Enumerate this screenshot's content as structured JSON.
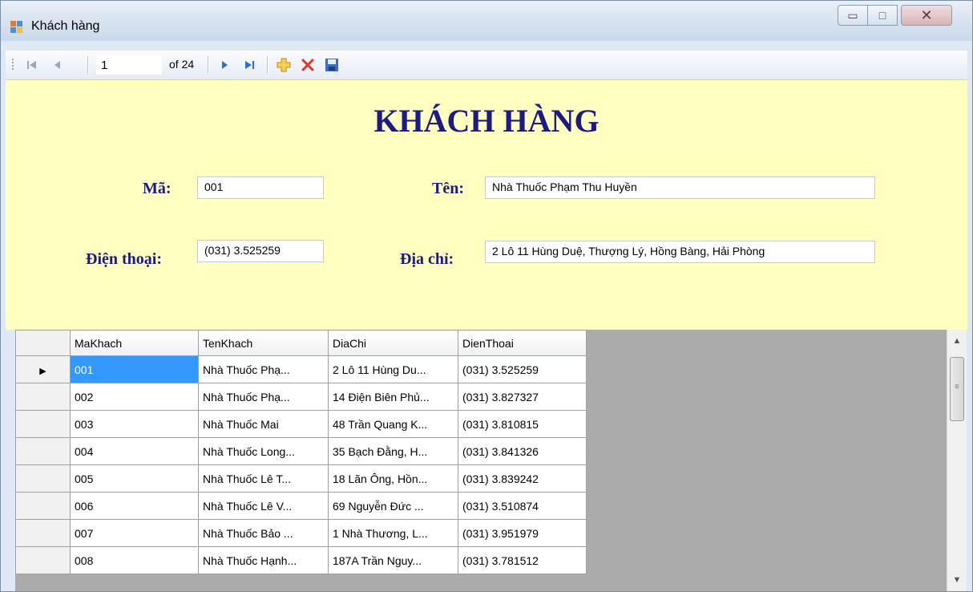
{
  "window": {
    "title": "Khách hàng",
    "controls": {
      "minimize": "▭",
      "maximize": "□",
      "close": "✕"
    }
  },
  "toolbar": {
    "position": "1",
    "count_label": "of 24",
    "icons": [
      "move-first-icon",
      "move-previous-icon",
      "move-next-icon",
      "move-last-icon",
      "add-new-icon",
      "delete-icon",
      "save-icon"
    ]
  },
  "form": {
    "heading": "KHÁCH HÀNG",
    "ma_label": "Mã:",
    "ma_value": "001",
    "ten_label": "Tên:",
    "ten_value": "Nhà Thuốc Phạm Thu Huyền",
    "dienthoai_label": "Điện thoại:",
    "dienthoai_value": "(031) 3.525259",
    "diachi_label": "Địa chỉ:",
    "diachi_value": "2 Lô 11 Hùng Duệ, Thượng Lý, Hồng Bàng, Hải Phòng"
  },
  "grid": {
    "columns": [
      "MaKhach",
      "TenKhach",
      "DiaChi",
      "DienThoai"
    ],
    "rows": [
      [
        "001",
        "Nhà Thuốc Phạ...",
        "2 Lô 11 Hùng Du...",
        "(031) 3.525259"
      ],
      [
        "002",
        "Nhà Thuốc Phạ...",
        "14 Điện Biên Phủ...",
        "(031) 3.827327"
      ],
      [
        "003",
        "Nhà Thuốc Mai",
        "48 Trần Quang K...",
        "(031) 3.810815"
      ],
      [
        "004",
        "Nhà Thuốc Long...",
        "35 Bạch Đằng, H...",
        "(031) 3.841326"
      ],
      [
        "005",
        "Nhà Thuốc Lê T...",
        "18 Lãn Ông, Hồn...",
        "(031) 3.839242"
      ],
      [
        "006",
        "Nhà Thuốc Lê V...",
        "69 Nguyễn Đức ...",
        "(031) 3.510874"
      ],
      [
        "007",
        "Nhà Thuốc Bảo ...",
        "1 Nhà Thương, L...",
        "(031) 3.951979"
      ],
      [
        "008",
        "Nhà Thuốc Hạnh...",
        "187A Trần Nguy...",
        "(031) 3.781512"
      ]
    ],
    "current_row_marker": "▶"
  },
  "colors": {
    "form_bg": "#ffffc0",
    "heading": "#1c1a86",
    "selection": "#3399ff"
  }
}
